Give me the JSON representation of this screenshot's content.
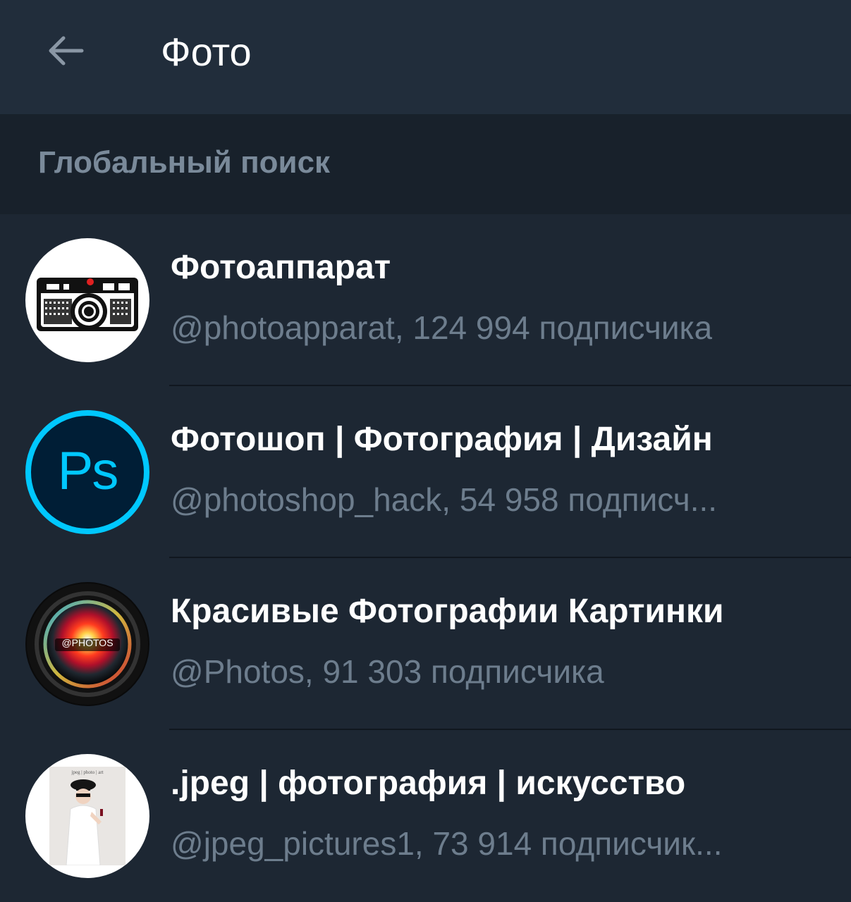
{
  "header": {
    "title": "Фото"
  },
  "section": {
    "label": "Глобальный поиск"
  },
  "results": [
    {
      "name": "Фотоаппарат",
      "subtitle": "@photoapparat, 124 994 подписчика",
      "avatar_icon": "camera-icon"
    },
    {
      "name": "Фотошоп | Фотография | Дизайн",
      "subtitle": "@photoshop_hack, 54 958 подписч...",
      "avatar_icon": "photoshop-logo-icon",
      "avatar_text": "Ps"
    },
    {
      "name": "Красивые Фотографии Картинки",
      "subtitle": "@Photos, 91 303 подписчика",
      "avatar_icon": "camera-lens-icon",
      "avatar_text": "@PHOTOS"
    },
    {
      "name": ".jpeg | фотография | искусство",
      "subtitle": "@jpeg_pictures1, 73 914 подписчик...",
      "avatar_icon": "portrait-photo-icon",
      "avatar_text": "jpeg | photo | art"
    }
  ],
  "colors": {
    "background": "#1d2733",
    "header": "#212d3b",
    "section": "#18212b",
    "accent_ps": "#00c8ff"
  }
}
